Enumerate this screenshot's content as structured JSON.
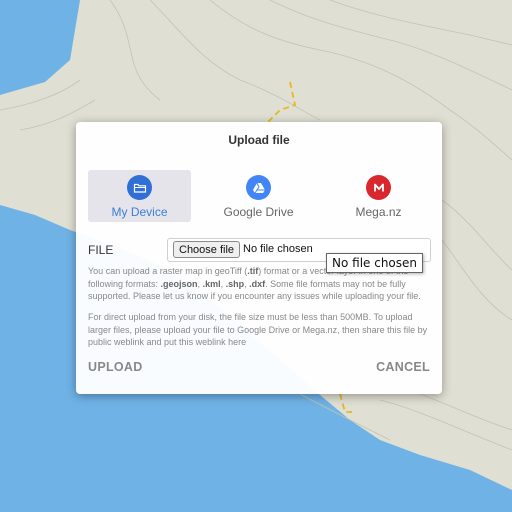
{
  "dialog": {
    "title": "Upload file",
    "sources": [
      {
        "label": "My Device",
        "icon": "folder-icon",
        "color": "#2f6fd6",
        "active": true
      },
      {
        "label": "Google Drive",
        "icon": "google-drive-icon",
        "color": "#4285f4",
        "active": false
      },
      {
        "label": "Mega.nz",
        "icon": "mega-icon",
        "color": "#d9272e",
        "active": false
      }
    ],
    "file_label": "FILE",
    "choose_button": "Choose file",
    "file_status": "No file chosen",
    "tooltip": "No file chosen",
    "info1": {
      "text_a": "You can upload a raster map in geoTiff (",
      "tif": ".tif",
      "text_b": ") format or a vector layer in one of the following formats: ",
      "geojson": ".geojson",
      "kml": ".kml",
      "shp": ".shp",
      "dxf": ".dxf",
      "text_c": ". Some file formats may not be fully supported. Please let us know if you encounter any issues while uploading your file."
    },
    "info2": "For direct upload from your disk, the file size must be less than 500MB. To upload larger files, please upload your file to Google Drive or Mega.nz, then share this file by public weblink and put this weblink here",
    "upload_button": "UPLOAD",
    "cancel_button": "CANCEL"
  },
  "colors": {
    "water": "#6fb2e6",
    "land": "#dfdfd3",
    "contour": "#b8b8a8",
    "trail": "#e8b820",
    "accent": "#3b7fd6"
  }
}
